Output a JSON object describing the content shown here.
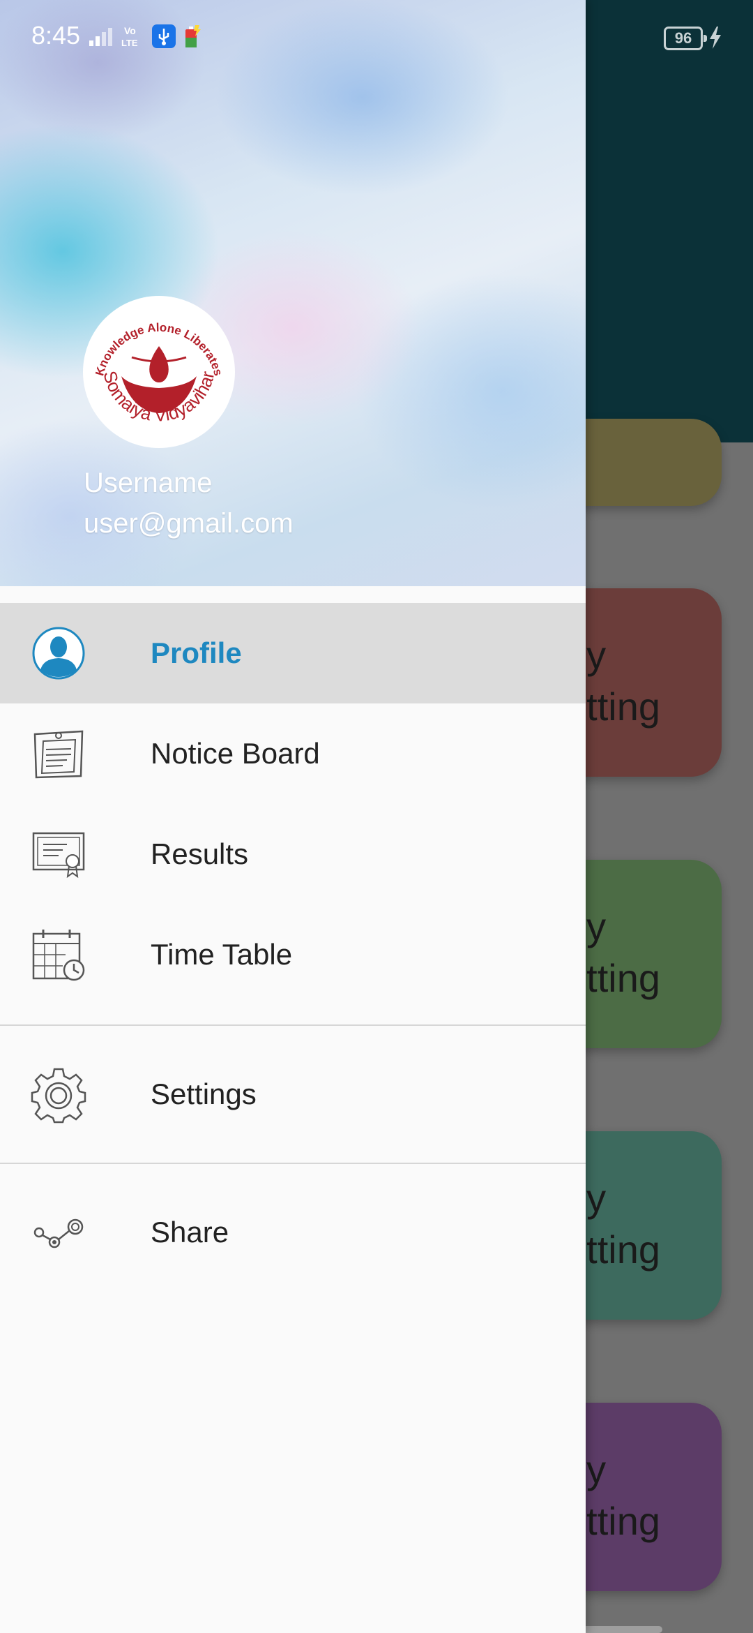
{
  "status_bar": {
    "time": "8:45",
    "battery": "96"
  },
  "drawer": {
    "logo_icon": "somaiya-vidyavihar-logo",
    "username": "Username",
    "email": "user@gmail.com",
    "items": [
      {
        "label": "Profile",
        "icon": "profile-icon",
        "active": true
      },
      {
        "label": "Notice Board",
        "icon": "notice-board-icon"
      },
      {
        "label": "Results",
        "icon": "certificate-icon"
      },
      {
        "label": "Time Table",
        "icon": "calendar-icon"
      },
      {
        "label": "Settings",
        "icon": "gear-icon"
      },
      {
        "label": "Share",
        "icon": "share-icon"
      }
    ]
  },
  "background_cards": [
    {
      "line1": "ny",
      "line2": "etting",
      "color": "#6b3d3a"
    },
    {
      "line1": "ny",
      "line2": "etting",
      "color": "#4c6c45"
    },
    {
      "line1": "ny",
      "line2": "etting",
      "color": "#3d6a5e"
    },
    {
      "line1": "ny",
      "line2": "etting",
      "color": "#5c3c67"
    }
  ],
  "colors": {
    "accent": "#1e88c0",
    "toolbar": "#0b3138",
    "active_row": "#dcdcdc"
  }
}
